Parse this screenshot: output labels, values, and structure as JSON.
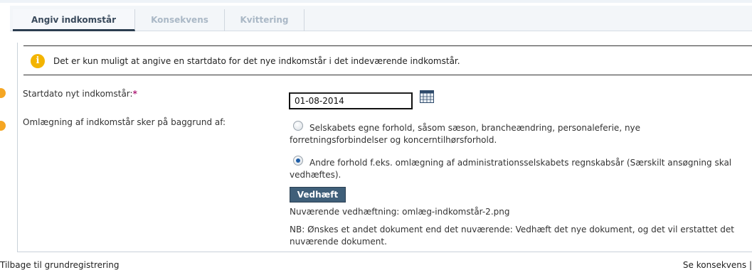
{
  "tabs": [
    {
      "label": "Angiv indkomstår",
      "active": true
    },
    {
      "label": "Konsekvens",
      "active": false
    },
    {
      "label": "Kvittering",
      "active": false
    }
  ],
  "info": {
    "icon": "info-icon",
    "text": "Det er kun muligt at angive en startdato for det nye indkomstår i det indeværende indkomstår."
  },
  "form": {
    "start_date_label": "Startdato nyt indkomstår:",
    "required_mark": "*",
    "start_date_value": "01-08-2014",
    "calendar_icon": "calendar-icon",
    "reason_label": "Omlægning af indkomstår sker på baggrund af:",
    "options": [
      {
        "text": "Selskabets egne forhold, såsom sæson, brancheændring, personaleferie, nye forretningsforbindelser og koncerntilhørsforhold.",
        "checked": false
      },
      {
        "text": "Andre forhold f.eks. omlægning af administrationsselskabets regnskabsår (Særskilt ansøgning skal vedhæftes).",
        "checked": true
      }
    ],
    "attach_button": "Vedhæft",
    "current_attachment": "Nuværende vedhæftning: omlæg-indkomstår-2.png",
    "note": "NB: Ønskes et andet dokument end det nuværende: Vedhæft det nye dokument, og det vil erstattet det nuværende dokument."
  },
  "footer": {
    "back_link": "Tilbage til grundregistrering",
    "next_link": "Se konsekvens |"
  },
  "colors": {
    "accent": "#f5a623",
    "button": "#3f5f79",
    "required": "#b0247a"
  }
}
